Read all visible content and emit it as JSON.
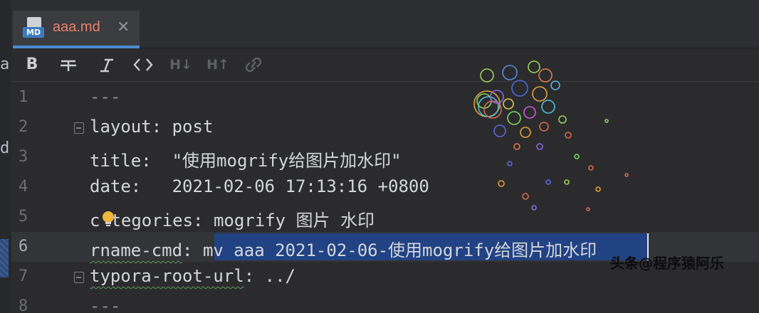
{
  "left_strip": {
    "chars": [
      "a",
      "d"
    ]
  },
  "tab": {
    "icon_label": "MD",
    "title": "aaa.md",
    "close_glyph": "✕"
  },
  "toolbar": {
    "bold": "B",
    "heading_down": "H↓",
    "heading_up": "H↑",
    "icons": [
      "bold-icon",
      "strikethrough-icon",
      "italic-icon",
      "code-icon",
      "heading-decrease-icon",
      "heading-increase-icon",
      "link-icon"
    ]
  },
  "editor": {
    "line_numbers": [
      "1",
      "2",
      "3",
      "4",
      "5",
      "6",
      "7",
      "8"
    ],
    "lines": [
      "---",
      "layout: post",
      "title:  \"使用mogrify给图片加水印\"",
      "date:   2021-02-06 17:13:16 +0800",
      "categories: mogrify 图片 水印",
      "rname-cmd: mv aaa 2021-02-06-使用mogrify给图片加水印",
      "typora-root-url: ../",
      "---"
    ],
    "line5_prefix": "c",
    "line5_rest": "tegories: mogrify 图片 水印",
    "line6_key": "rname-cmd",
    "line6_sep": ": ",
    "line6_selected": "mv aaa 2021-02-06-使用mogrify给图片加水印",
    "line7_key": "typora-root-url",
    "line7_rest": ": ../"
  },
  "watermark": "头条@程序猿阿乐",
  "colors": {
    "tab_title": "#e8826b",
    "tab_underline": "#4a8ad0",
    "selection": "#214283",
    "background": "#2b2b2d"
  }
}
